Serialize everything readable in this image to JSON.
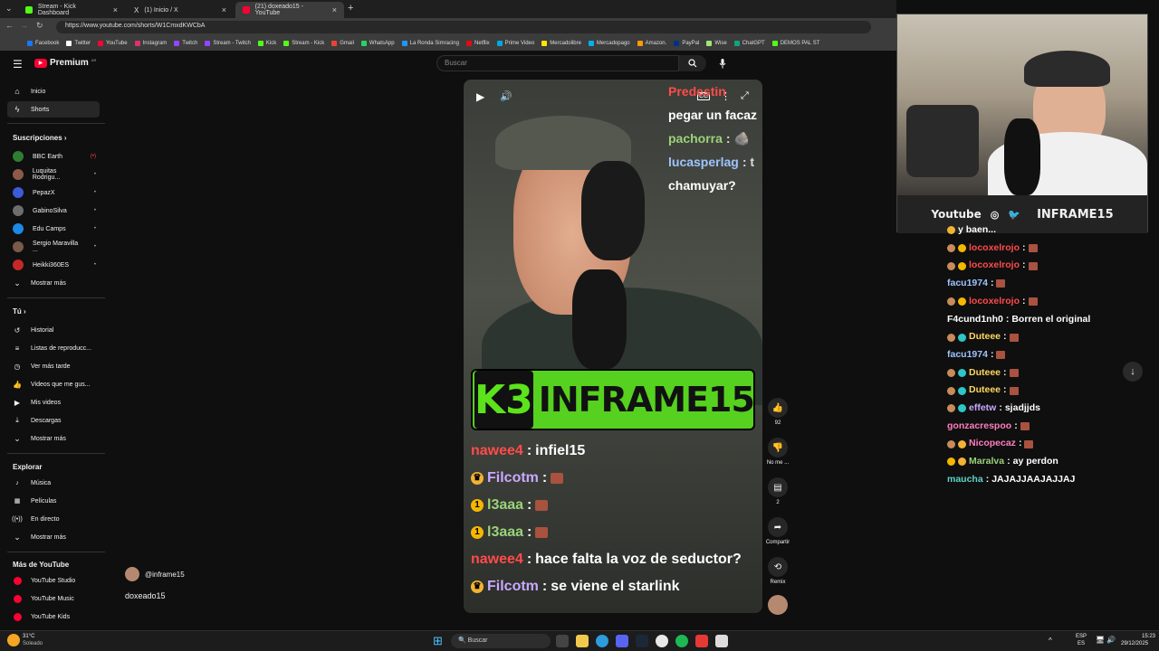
{
  "browser": {
    "tabs": [
      {
        "label": "Stream - Kick Dashboard",
        "color": "#53fc18"
      },
      {
        "label": "(1) Inicio / X",
        "color": "#ffffff"
      },
      {
        "label": "(21) doxeado15 - YouTube",
        "color": "#ff0033"
      }
    ],
    "url": "https://www.youtube.com/shorts/W1CmxdKWCbA",
    "bookmarks": [
      "Facebook",
      "Twitter",
      "YouTube",
      "Instagram",
      "Twitch",
      "Stream - Twitch",
      "Kick",
      "Stream - Kick",
      "Gmail",
      "WhatsApp",
      "La Ronda Simracing",
      "Netflix",
      "Prime Video",
      "Mercadolibre",
      "Mercadopago",
      "Amazon.",
      "PayPal",
      "Wise",
      "ChatGPT",
      "DEMOS PAL ST"
    ]
  },
  "yt": {
    "logo": "Premium",
    "logo_sup": "AR",
    "search_placeholder": "Buscar",
    "nav": [
      {
        "label": "Inicio",
        "icon": "home-icon"
      },
      {
        "label": "Shorts",
        "icon": "shorts-icon"
      }
    ],
    "subs_title": "Suscripciones",
    "subs": [
      {
        "name": "BBC Earth",
        "color": "#2e7d32",
        "dot": "(•)"
      },
      {
        "name": "Luquitas Rodrigu...",
        "color": "#8d5a4a",
        "dot": "•"
      },
      {
        "name": "PepazX",
        "color": "#3b5bdb",
        "dot": "•"
      },
      {
        "name": "GabinoSilva",
        "color": "#6d6d6d",
        "dot": "•"
      },
      {
        "name": "Edu Camps",
        "color": "#1e88e5",
        "dot": "•"
      },
      {
        "name": "Sergio Maravilla ...",
        "color": "#7a5a48",
        "dot": "•"
      },
      {
        "name": "Heikki360ES",
        "color": "#c62828",
        "dot": "•"
      }
    ],
    "show_more": "Mostrar más",
    "you_title": "Tú",
    "you": [
      {
        "label": "Historial",
        "icon": "history-icon"
      },
      {
        "label": "Listas de reproducc...",
        "icon": "playlist-icon"
      },
      {
        "label": "Ver más tarde",
        "icon": "clock-icon"
      },
      {
        "label": "Videos que me gus...",
        "icon": "like-icon"
      },
      {
        "label": "Mis videos",
        "icon": "video-icon"
      },
      {
        "label": "Descargas",
        "icon": "download-icon"
      }
    ],
    "explore_title": "Explorar",
    "explore": [
      {
        "label": "Música",
        "icon": "music-icon"
      },
      {
        "label": "Películas",
        "icon": "film-icon"
      },
      {
        "label": "En directo",
        "icon": "live-icon"
      }
    ],
    "more_title": "Más de YouTube",
    "more": [
      "YouTube Studio",
      "YouTube Music",
      "YouTube Kids"
    ],
    "channel": "@inframe15",
    "video_title": "doxeado15",
    "likes": "92",
    "dislike_label": "No me ...",
    "comments": "2",
    "share_label": "Compartir",
    "remix_label": "Remix"
  },
  "short": {
    "banner": "INFRAME15",
    "banner_logo": "K3",
    "overlay_top": [
      {
        "user": "Predestin",
        "color": "#ff4b4b",
        "msg": ""
      },
      {
        "user": "",
        "color": "#ffffff",
        "msg": "pegar un facaz"
      },
      {
        "user": "pachorra",
        "color": "#9ad27a",
        "msg": ": 🪨"
      },
      {
        "user": "lucasperlag",
        "color": "#9ec4ff",
        "msg": ": t"
      },
      {
        "user": "",
        "color": "#ffffff",
        "msg": "chamuyar?"
      }
    ],
    "chat": [
      {
        "user": "nawee4",
        "color": "#ff4b4b",
        "msg": "infiel15",
        "badge": "",
        "emote": false
      },
      {
        "user": "Filcotm",
        "color": "#c9a8ff",
        "msg": "",
        "badge": "crown",
        "emote": true
      },
      {
        "user": "l3aaa",
        "color": "#9ad27a",
        "msg": "",
        "badge": "one",
        "emote": true
      },
      {
        "user": "l3aaa",
        "color": "#9ad27a",
        "msg": "",
        "badge": "one",
        "emote": true
      },
      {
        "user": "nawee4",
        "color": "#ff4b4b",
        "msg": "hace falta la voz de seductor?",
        "badge": "",
        "emote": false
      },
      {
        "user": "Filcotm",
        "color": "#c9a8ff",
        "msg": "se viene el starlink",
        "badge": "crown",
        "emote": false
      }
    ]
  },
  "cam": {
    "youtube": "Youtube",
    "handle": "INFRAME15"
  },
  "side_chat": [
    {
      "user": "",
      "color": "#ffffff",
      "msg": "y baen...",
      "badges": [
        "crown"
      ],
      "emote": false
    },
    {
      "user": "locoxelrojo",
      "color": "#ff4b4b",
      "msg": "",
      "badges": [
        "fist",
        "one"
      ],
      "emote": true
    },
    {
      "user": "locoxelrojo",
      "color": "#ff4b4b",
      "msg": "",
      "badges": [
        "fist",
        "one"
      ],
      "emote": true
    },
    {
      "user": "facu1974",
      "color": "#9ec4ff",
      "msg": "",
      "badges": [],
      "emote": true
    },
    {
      "user": "locoxelrojo",
      "color": "#ff4b4b",
      "msg": "",
      "badges": [
        "fist",
        "one"
      ],
      "emote": true
    },
    {
      "user": "F4cund1nh0",
      "color": "#ffffff",
      "msg": "Borren el original",
      "badges": [],
      "emote": false
    },
    {
      "user": "Duteee",
      "color": "#ffd75e",
      "msg": "",
      "badges": [
        "fist",
        "gem"
      ],
      "emote": true
    },
    {
      "user": "facu1974",
      "color": "#9ec4ff",
      "msg": "",
      "badges": [],
      "emote": true
    },
    {
      "user": "Duteee",
      "color": "#ffd75e",
      "msg": "",
      "badges": [
        "fist",
        "gem"
      ],
      "emote": true
    },
    {
      "user": "Duteee",
      "color": "#ffd75e",
      "msg": "",
      "badges": [
        "fist",
        "gem"
      ],
      "emote": true
    },
    {
      "user": "effetw",
      "color": "#c9a8ff",
      "msg": "sjadjjds",
      "badges": [
        "fist",
        "gem"
      ],
      "emote": false
    },
    {
      "user": "gonzacrespoo",
      "color": "#ff7dbd",
      "msg": "",
      "badges": [],
      "emote": true
    },
    {
      "user": "Nicopecaz",
      "color": "#ff7dbd",
      "msg": "",
      "badges": [
        "fist",
        "crown"
      ],
      "emote": true
    },
    {
      "user": "Maralva",
      "color": "#9ad27a",
      "msg": "ay perdon",
      "badges": [
        "one",
        "crown"
      ],
      "emote": false
    },
    {
      "user": "maucha",
      "color": "#5fd3c6",
      "msg": "JAJAJJAAJAJJAJ",
      "badges": [],
      "emote": false
    }
  ],
  "taskbar": {
    "weather_temp": "31°C",
    "weather_text": "Soleado",
    "search": "Buscar",
    "lang1": "ESP",
    "lang2": "ES",
    "time": "15:23",
    "date": "29/12/2025"
  }
}
